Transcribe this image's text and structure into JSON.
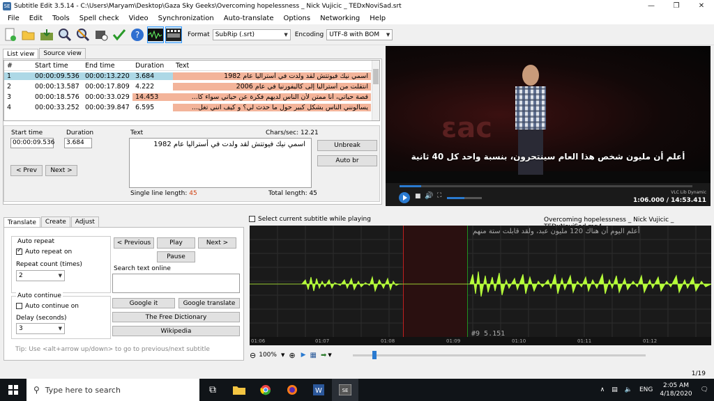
{
  "window": {
    "title": "Subtitle Edit 3.5.14 - C:\\Users\\Maryam\\Desktop\\Gaza Sky Geeks\\Overcoming hopelessness _ Nick Vujicic _ TEDxNoviSad.srt",
    "minimize": "—",
    "maximize": "❐",
    "close": "✕",
    "app_icon": "SE"
  },
  "menu": [
    "File",
    "Edit",
    "Tools",
    "Spell check",
    "Video",
    "Synchronization",
    "Auto-translate",
    "Options",
    "Networking",
    "Help"
  ],
  "toolbar": {
    "format_label": "Format",
    "format_value": "SubRip (.srt)",
    "encoding_label": "Encoding",
    "encoding_value": "UTF-8 with BOM"
  },
  "view_tabs": [
    "List view",
    "Source view"
  ],
  "list": {
    "headers": [
      "#",
      "Start time",
      "End time",
      "Duration",
      "Text"
    ],
    "rows": [
      {
        "n": "1",
        "start": "00:00:09.536",
        "end": "00:00:13.220",
        "dur": "3.684",
        "text": "اسمي نيك فيوتتش لقد ولدت في أستراليا عام 1982"
      },
      {
        "n": "2",
        "start": "00:00:13.587",
        "end": "00:00:17.809",
        "dur": "4.222",
        "text": "انتقلت من أستراليا إلى كاليفورنيا في عام 2006"
      },
      {
        "n": "3",
        "start": "00:00:18.576",
        "end": "00:00:33.029",
        "dur": "14.453",
        "text": "قصة حياتي، أنا ممتن لأن الناس لديهم فكرة عن حياتي سواء كا..."
      },
      {
        "n": "4",
        "start": "00:00:33.252",
        "end": "00:00:39.847",
        "dur": "6.595",
        "text": "يسألونني الناس بشكل كبير حول ما حدث لي؟ و كيف انني تغل..."
      }
    ]
  },
  "editor": {
    "start_label": "Start time",
    "start_value": "00:00:09.536",
    "duration_label": "Duration",
    "duration_value": "3.684",
    "text_label": "Text",
    "chars_sec": "Chars/sec: 12.21",
    "text_value": "اسمي نيك فيوتتش لقد ولدت في أستراليا عام 1982",
    "unbreak": "Unbreak",
    "auto_br": "Auto br",
    "prev": "< Prev",
    "next": "Next >",
    "single_line_label": "Single line length:",
    "single_line_value": "45",
    "total_length": "Total length: 45"
  },
  "video": {
    "subtitle": "أعلم أن مليون شخص هذا العام سينتحرون، بنسبة واحد كل 40 ثانية",
    "vlc": "VLC Lib Dynamic",
    "time": "1:06.000 / 14:53.411",
    "progress": 0.074
  },
  "bottom_tabs": [
    "Translate",
    "Create",
    "Adjust"
  ],
  "translate": {
    "auto_repeat": "Auto repeat",
    "auto_repeat_on": "Auto repeat on",
    "repeat_count_label": "Repeat count (times)",
    "repeat_count": "2",
    "auto_continue": "Auto continue",
    "auto_continue_on": "Auto continue on",
    "delay_label": "Delay (seconds)",
    "delay": "3",
    "previous": "< Previous",
    "play": "Play",
    "next": "Next >",
    "pause": "Pause",
    "search_label": "Search text online",
    "google_it": "Google it",
    "google_translate": "Google translate",
    "free_dictionary": "The Free Dictionary",
    "wikipedia": "Wikipedia",
    "tip": "Tip: Use <alt+arrow up/down> to go to previous/next subtitle"
  },
  "waveform": {
    "select_label": "Select current subtitle while playing",
    "file": "Overcoming hopelessness _ Nick Vujicic _ TEDxNoviSad.mp4",
    "overlay_text": "أعلم اليوم أن هناك 120 مليون عبد، ولقد قابلت ستة منهم",
    "marker": "#9  5.151",
    "ticks": [
      "01:06",
      "01:07",
      "01:08",
      "01:09",
      "01:10",
      "01:11",
      "01:12"
    ],
    "zoom": "100%"
  },
  "status": {
    "page": "1/19"
  },
  "taskbar": {
    "search": "Type here to search",
    "lang": "ENG",
    "time": "2:05 AM",
    "date": "4/18/2020"
  }
}
